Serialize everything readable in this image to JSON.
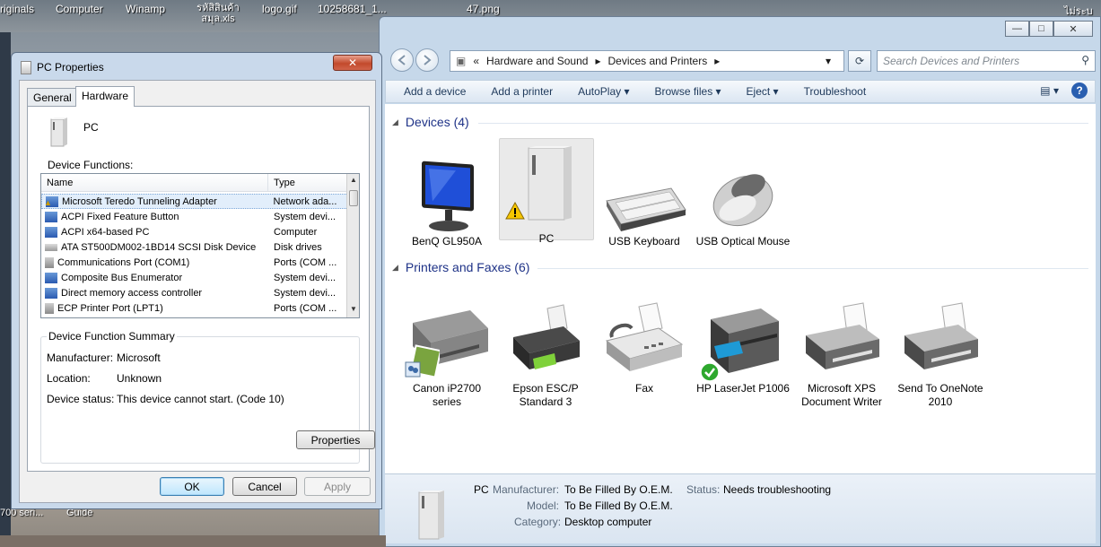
{
  "desktop": {
    "icon_labels": [
      "riginals",
      "Computer",
      "Winamp",
      "รหัสิสินค้า สมุล.xls",
      "logo.gif",
      "10258681_1...",
      "47.png",
      "ไม่ระบ"
    ],
    "bottom_labels": [
      "700 seri...",
      "Guide"
    ]
  },
  "devices_window": {
    "caption_buttons": {
      "minimize": "—",
      "maximize": "□",
      "close": "✕"
    },
    "breadcrumb": [
      "«",
      "Hardware and Sound",
      "▸",
      "Devices and Printers",
      "▸"
    ],
    "search_placeholder": "Search Devices and Printers",
    "toolbar": [
      "Add a device",
      "Add a printer",
      "AutoPlay ▾",
      "Browse files ▾",
      "Eject ▾",
      "Troubleshoot"
    ],
    "help_label": "?",
    "groups": [
      {
        "title": "Devices (4)"
      },
      {
        "title": "Printers and Faxes (6)"
      }
    ],
    "devices": [
      {
        "label": "BenQ GL950A",
        "icon": "monitor-icon"
      },
      {
        "label": "PC",
        "icon": "pc-tower-icon",
        "warning": true,
        "selected": true
      },
      {
        "label": "USB Keyboard",
        "icon": "keyboard-icon"
      },
      {
        "label": "USB Optical Mouse",
        "icon": "mouse-icon"
      }
    ],
    "printers": [
      {
        "label": "Canon iP2700 series",
        "icon": "printer-icon"
      },
      {
        "label": "Epson ESC/P Standard 3",
        "icon": "printer-icon"
      },
      {
        "label": "Fax",
        "icon": "fax-icon"
      },
      {
        "label": "HP LaserJet P1006",
        "icon": "multifunction-printer-icon",
        "default": true
      },
      {
        "label": "Microsoft XPS Document Writer",
        "icon": "printer-icon"
      },
      {
        "label": "Send To OneNote 2010",
        "icon": "printer-icon"
      }
    ],
    "details": {
      "name": "PC",
      "manufacturer_label": "Manufacturer:",
      "manufacturer": "To Be Filled By O.E.M.",
      "model_label": "Model:",
      "model": "To Be Filled By O.E.M.",
      "category_label": "Category:",
      "category": "Desktop computer",
      "status_label": "Status:",
      "status": "Needs troubleshooting"
    }
  },
  "properties_dialog": {
    "title": "PC Properties",
    "close_label": "✕",
    "tabs": [
      "General",
      "Hardware"
    ],
    "device_name": "PC",
    "functions_label": "Device Functions:",
    "columns": [
      "Name",
      "Type"
    ],
    "rows": [
      {
        "name": "Microsoft Teredo Tunneling Adapter",
        "type": "Network ada...",
        "warn": true
      },
      {
        "name": "ACPI Fixed Feature Button",
        "type": "System devi..."
      },
      {
        "name": "ACPI x64-based PC",
        "type": "Computer"
      },
      {
        "name": "ATA ST500DM002-1BD14 SCSI Disk Device",
        "type": "Disk drives"
      },
      {
        "name": "Communications Port (COM1)",
        "type": "Ports (COM ..."
      },
      {
        "name": "Composite Bus Enumerator",
        "type": "System devi..."
      },
      {
        "name": "Direct memory access controller",
        "type": "System devi..."
      },
      {
        "name": "ECP Printer Port (LPT1)",
        "type": "Ports (COM ..."
      }
    ],
    "summary": {
      "title": "Device Function Summary",
      "manufacturer_label": "Manufacturer:",
      "manufacturer": "Microsoft",
      "location_label": "Location:",
      "location": "Unknown",
      "status_label": "Device status:",
      "status": "This device cannot start. (Code 10)"
    },
    "buttons": {
      "properties": "Properties",
      "ok": "OK",
      "cancel": "Cancel",
      "apply": "Apply"
    }
  }
}
